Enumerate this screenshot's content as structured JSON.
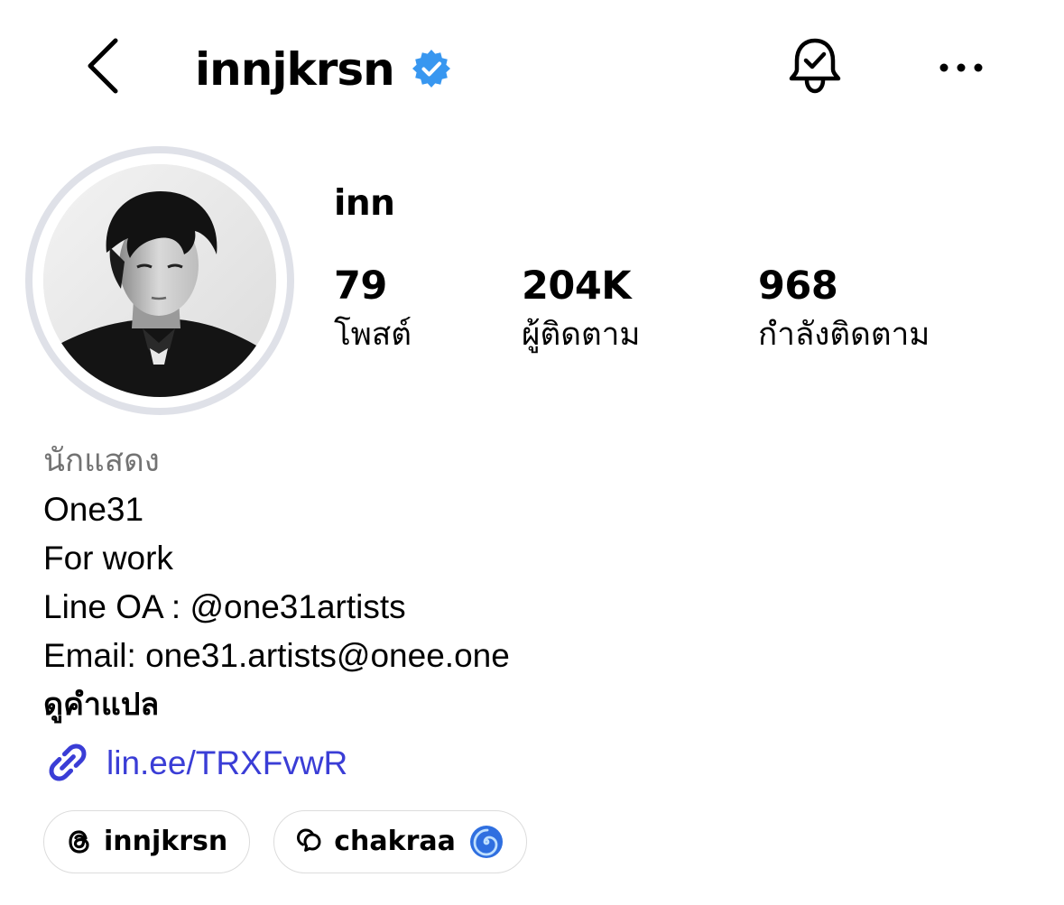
{
  "header": {
    "username": "innjkrsn",
    "verified": true,
    "icons": {
      "back": "chevron-left-icon",
      "verified": "verified-badge-icon",
      "notifications": "bell-check-icon",
      "more": "more-horizontal-icon"
    },
    "accent_color": "#3897f0"
  },
  "profile": {
    "display_name": "inn",
    "avatar": "profile-photo",
    "stats": [
      {
        "value": "79",
        "label": "โพสต์"
      },
      {
        "value": "204K",
        "label": "ผู้ติดตาม"
      },
      {
        "value": "968",
        "label": "กำลังติดตาม"
      }
    ]
  },
  "bio": {
    "category": "นักแสดง",
    "lines": [
      "One31",
      "For work",
      "Line OA : @one31artists",
      "Email: one31.artists@onee.one"
    ],
    "translate_label": "ดูคำแปล",
    "link": {
      "icon": "link-icon",
      "text": "lin.ee/TRXFvwR",
      "color": "#3a3dd6"
    }
  },
  "pills": [
    {
      "icon": "threads-icon",
      "label": "innjkrsn"
    },
    {
      "icon": "chat-bubbles-icon",
      "label": "chakraa",
      "emoji": "cyclone-emoji"
    }
  ]
}
